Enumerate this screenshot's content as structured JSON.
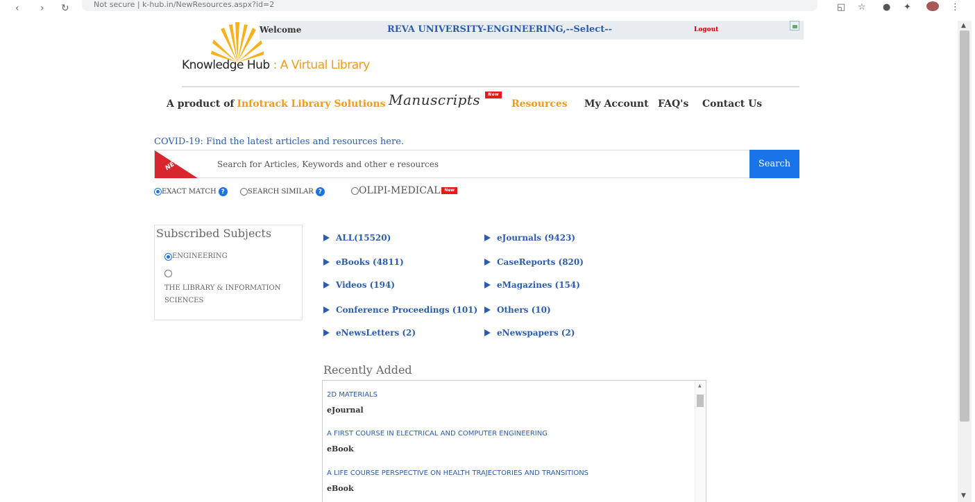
{
  "browser": {
    "url_text": "Not secure | k-hub.in/NewResources.aspx?id=2"
  },
  "welcome_bar": {
    "welcome": "Welcome",
    "institution": "REVA UNIVERSITY-ENGINEERING,--Select--",
    "logout": "Logout"
  },
  "logo": {
    "name": "Knowledge Hub",
    "separator": " : ",
    "tagline": "A Virtual Library"
  },
  "nav": {
    "product_of": "A product of",
    "infotrack": "Infotrack Library Solutions",
    "manuscripts": "Manuscripts",
    "new_badge": "New",
    "resources": "Resources",
    "my_account": "My Account",
    "faqs": "FAQ's",
    "contact": "Contact Us"
  },
  "covid_link": "COVID-19: Find the latest articles and resources here.",
  "search": {
    "ribbon": "NEW!",
    "placeholder": "Search for Articles, Keywords and other e resources",
    "button": "Search",
    "exact_match": "EXACT MATCH",
    "search_similar": "SEARCH SIMILAR",
    "olipi": "OLIPI-MEDICAL",
    "help_icon": "?",
    "new_badge": "New"
  },
  "subjects": {
    "title": "Subscribed Subjects",
    "items": [
      {
        "label": "ENGINEERING",
        "selected": true
      },
      {
        "label": "THE LIBRARY & INFORMATION SCIENCES",
        "selected": false
      }
    ]
  },
  "resources": [
    {
      "label": "ALL(15520)"
    },
    {
      "label": "eJournals (9423)"
    },
    {
      "label": "eBooks (4811)"
    },
    {
      "label": "CaseReports (820)"
    },
    {
      "label": "Videos (194)"
    },
    {
      "label": "eMagazines (154)"
    },
    {
      "label": "Conference Proceedings (101)"
    },
    {
      "label": "Others (10)"
    },
    {
      "label": "eNewsLetters (2)"
    },
    {
      "label": "eNewspapers (2)"
    }
  ],
  "recently_added": {
    "title": "Recently Added",
    "items": [
      {
        "title": "2D MATERIALS",
        "kind": "eJournal"
      },
      {
        "title": "A FIRST COURSE IN ELECTRICAL AND COMPUTER ENGINEERING",
        "kind": "eBook"
      },
      {
        "title": "A LIFE COURSE PERSPECTIVE ON HEALTH TRAJECTORIES AND TRANSITIONS",
        "kind": "eBook"
      }
    ]
  },
  "colors": {
    "accent_orange": "#f29a1a",
    "link_blue": "#2a5db0",
    "button_blue": "#1a73e8",
    "badge_red": "#e41b1b"
  }
}
